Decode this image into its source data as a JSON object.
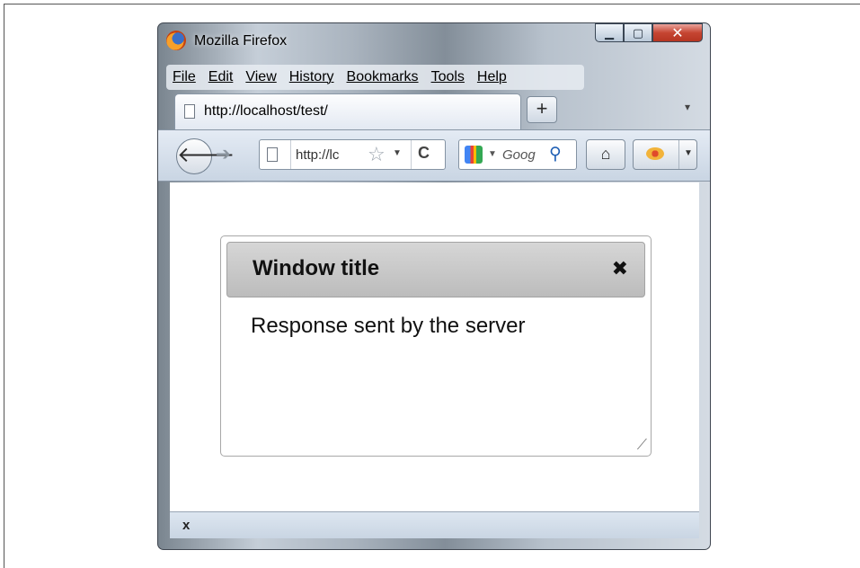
{
  "window": {
    "title": "Mozilla Firefox",
    "minimize_glyph": "▁",
    "maximize_glyph": "▢",
    "close_glyph": "✕"
  },
  "menubar": {
    "items": [
      "File",
      "Edit",
      "View",
      "History",
      "Bookmarks",
      "Tools",
      "Help"
    ]
  },
  "tabs": {
    "active_label": "http://localhost/test/",
    "new_tab_glyph": "+",
    "list_glyph": "▾"
  },
  "navbar": {
    "back_glyph": "🡐",
    "forward_glyph": "➔",
    "url_value": "http://localhost/test/",
    "url_display": "http://lc",
    "star_glyph": "☆",
    "dropdown_glyph": "▼",
    "reload_glyph": "C",
    "search_placeholder": "Google",
    "search_display": "Goog",
    "search_glyph": "⚲",
    "home_glyph": "⌂",
    "addon_dropdown_glyph": "▼"
  },
  "dialog": {
    "title": "Window title",
    "close_glyph": "✖",
    "body": "Response sent by the server",
    "resize_glyph": "⟋"
  },
  "statusbar": {
    "close_glyph": "x"
  },
  "icons": {
    "firefox-logo": "firefox-icon",
    "page": "page-icon",
    "search-engine": "google-icon",
    "addon": "ladybug-icon"
  }
}
